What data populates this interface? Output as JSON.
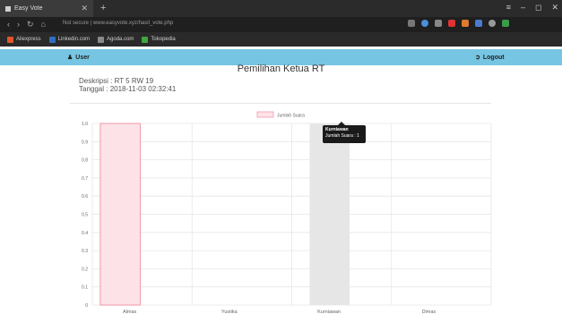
{
  "browser": {
    "tab_title": "Easy Vote",
    "url": "Not secure | www.easyvote.xyz/hasil_vote.php",
    "bookmarks": [
      "Aliexpress",
      "Linkedin.com",
      "Agoda.com",
      "Tokopedia"
    ]
  },
  "navbar": {
    "user_label": "User",
    "logout_label": "Logout"
  },
  "page": {
    "title": "Pemilihan Ketua RT",
    "description": "Deskripsi : RT 5 RW 19",
    "date": "Tanggal : 2018-11-03 02:32:41"
  },
  "tooltip": {
    "title": "Kurniawan",
    "body": "Jumlah Suara : 1"
  },
  "chart_data": {
    "type": "bar",
    "categories": [
      "Almas",
      "Yustika",
      "Kurniawan",
      "Dimas"
    ],
    "series": [
      {
        "name": "Jumlah Suara",
        "values": [
          1,
          0,
          1,
          0
        ]
      }
    ],
    "ylim": [
      0,
      1.0
    ],
    "yticks": [
      "0",
      "0.1",
      "0.2",
      "0.3",
      "0.4",
      "0.5",
      "0.6",
      "0.7",
      "0.8",
      "0.9",
      "1.0"
    ],
    "legend": "top",
    "grid": true,
    "colors": {
      "bar_fill": "#fde3e8",
      "bar_stroke": "#f38da1",
      "hover_fill": "#e6e6e6"
    }
  }
}
